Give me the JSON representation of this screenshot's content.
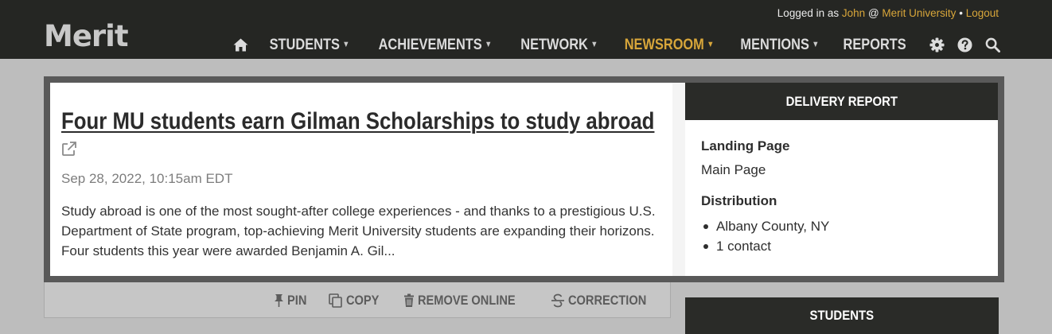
{
  "header": {
    "logo": "Merit",
    "user": {
      "prefix": "Logged in as",
      "name": "John",
      "at": "@",
      "org": "Merit University",
      "separator": "•",
      "logout": "Logout"
    },
    "nav": [
      {
        "label": "STUDENTS",
        "caret": "▼"
      },
      {
        "label": "ACHIEVEMENTS",
        "caret": "▼"
      },
      {
        "label": "NETWORK",
        "caret": "▼"
      },
      {
        "label": "NEWSROOM",
        "caret": "▼",
        "active": true
      },
      {
        "label": "MENTIONS",
        "caret": "▼"
      },
      {
        "label": "REPORTS"
      }
    ],
    "icons": [
      "home-icon",
      "gear-icon",
      "help-icon",
      "search-icon"
    ],
    "active_color": "#d8a63a"
  },
  "article": {
    "title": "Four MU students earn Gilman Scholarships to study abroad",
    "date": "Sep 28, 2022, 10:15am EDT",
    "summary": "Study abroad is one of the most sought-after college experiences - and thanks to a prestigious U.S. Department of State program, top-achieving Merit University students are expanding their horizons. Four students this year were awarded Benjamin A. Gil..."
  },
  "actions": [
    {
      "label": "PIN",
      "icon": "pin-icon"
    },
    {
      "label": "COPY",
      "icon": "copy-icon"
    },
    {
      "label": "REMOVE ONLINE",
      "icon": "trash-icon"
    },
    {
      "label": "CORRECTION",
      "icon": "strikethrough-icon"
    }
  ],
  "delivery_report": {
    "heading": "DELIVERY REPORT",
    "landing_label": "Landing Page",
    "landing_value": "Main Page",
    "distribution_label": "Distribution",
    "distribution": [
      "Albany County, NY",
      "1 contact"
    ]
  },
  "students_panel": {
    "heading": "STUDENTS"
  }
}
